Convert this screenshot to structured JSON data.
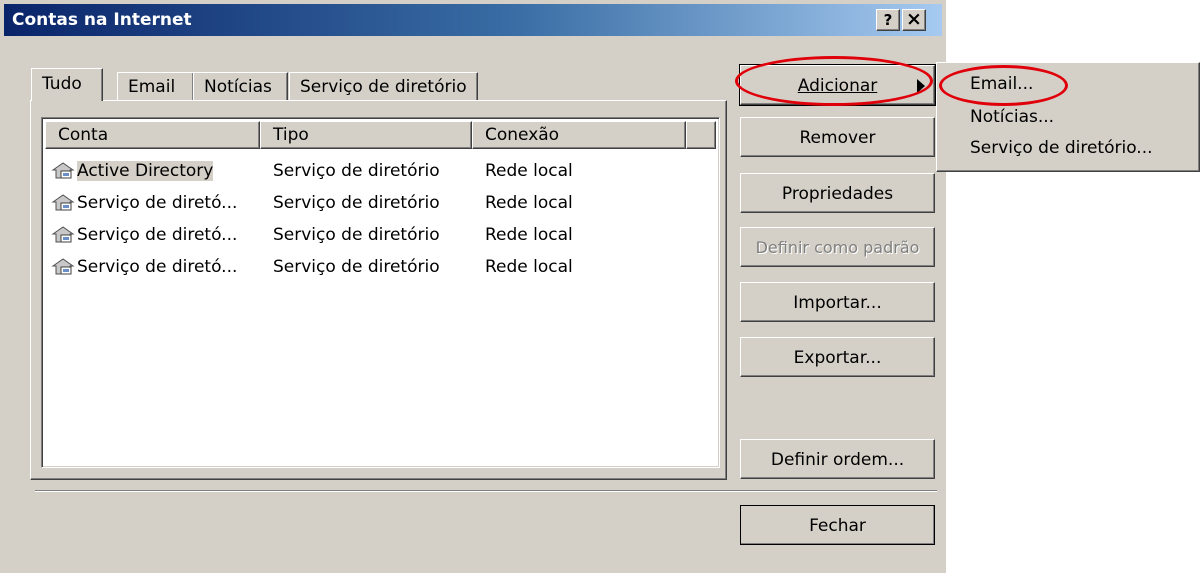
{
  "window": {
    "title": "Contas na Internet",
    "help_btn": "?",
    "close_btn": "×"
  },
  "tabs": [
    "Tudo",
    "Email",
    "Notícias",
    "Serviço de diretório"
  ],
  "list": {
    "columns": [
      "Conta",
      "Tipo",
      "Conexão"
    ],
    "rows": [
      {
        "account": "Active Directory",
        "type": "Serviço de diretório",
        "connection": "Rede local",
        "icon": "directory-service-icon"
      },
      {
        "account": "Serviço de diretó...",
        "type": "Serviço de diretório",
        "connection": "Rede local",
        "icon": "directory-service-icon"
      },
      {
        "account": "Serviço de diretó...",
        "type": "Serviço de diretório",
        "connection": "Rede local",
        "icon": "directory-service-icon"
      },
      {
        "account": "Serviço de diretó...",
        "type": "Serviço de diretório",
        "connection": "Rede local",
        "icon": "directory-service-icon"
      }
    ]
  },
  "buttons": {
    "add": "Adicionar",
    "remove": "Remover",
    "properties": "Propriedades",
    "set_default": "Definir como padrão",
    "import": "Importar...",
    "export": "Exportar...",
    "set_order": "Definir ordem...",
    "close": "Fechar"
  },
  "add_menu": {
    "items": [
      "Email...",
      "Notícias...",
      "Serviço de diretório..."
    ]
  },
  "colors": {
    "face": "#d4d0c8",
    "title_start": "#0a246a",
    "title_end": "#a6caf0",
    "highlight_ring": "#e0000a"
  }
}
